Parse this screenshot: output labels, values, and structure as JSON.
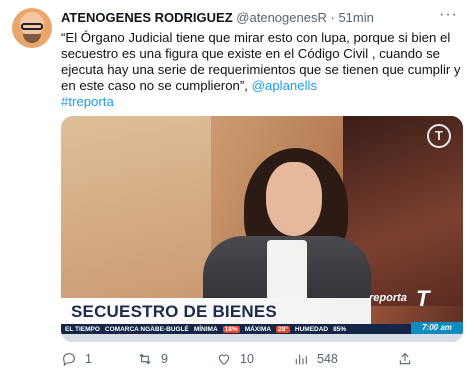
{
  "tweet": {
    "author_name": "ATENOGENES RODRIGUEZ",
    "handle": "@atenogenesR",
    "separator": "·",
    "time": "51min",
    "more_label": "···",
    "text_main": "“El Órgano Judicial tiene que mirar esto con lupa, porque si bien el secuestro es una figura que existe en el Código Civil , cuando se ejecuta hay una serie de requerimientos que se tienen que cumplir y en este caso no se cumplieron”, ",
    "mention": "@aplanells",
    "hashtag": "#treporta"
  },
  "media": {
    "channel_logo": "T",
    "banner_title": "SECUESTRO DE BIENES",
    "program_label": "reporta",
    "program_logo": "T",
    "ticker": {
      "weather_label": "EL TIEMPO",
      "region": "COMARCA NGÄBE-BUGLÉ",
      "min_label": "MÍNIMA",
      "min_value": "18%",
      "max_label": "MÁXIMA",
      "max_value": "28°",
      "humidity_label": "HUMEDAD",
      "humidity_value": "85%"
    },
    "clock": "7:00 am"
  },
  "actions": {
    "reply_count": "1",
    "retweet_count": "9",
    "like_count": "10",
    "views_count": "548"
  },
  "icons": [
    "reply-icon",
    "retweet-icon",
    "like-icon",
    "views-icon",
    "share-icon"
  ],
  "colors": {
    "link": "#1d9bf0",
    "secondary": "#536471"
  }
}
